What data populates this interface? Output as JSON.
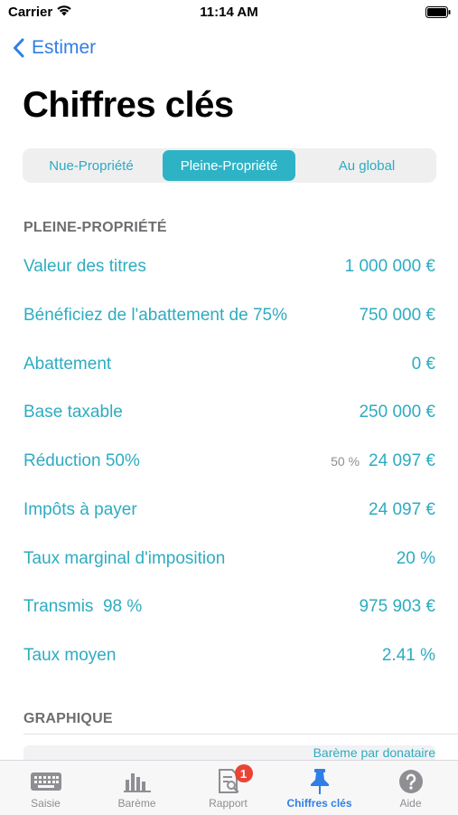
{
  "status_bar": {
    "carrier": "Carrier",
    "time": "11:14 AM"
  },
  "nav": {
    "back_label": "Estimer",
    "title": "Chiffres clés"
  },
  "segments": [
    {
      "label": "Nue-Propriété",
      "selected": false
    },
    {
      "label": "Pleine-Propriété",
      "selected": true
    },
    {
      "label": "Au global",
      "selected": false
    }
  ],
  "section_pp": {
    "header": "PLEINE-PROPRIÉTÉ",
    "rows": [
      {
        "label": "Valeur des titres",
        "value": "1 000 000 €"
      },
      {
        "label": "Bénéficiez de l'abattement de 75%",
        "value": "750 000 €"
      },
      {
        "label": "Abattement",
        "value": "0 €"
      },
      {
        "label": "Base taxable",
        "value": "250 000 €"
      },
      {
        "label": "Réduction 50%",
        "pct": "50 %",
        "value": "24 097 €"
      },
      {
        "label": "Impôts à payer",
        "value": "24 097 €"
      },
      {
        "label": "Taux marginal d'imposition",
        "value": "20 %"
      },
      {
        "label": "Transmis  98 %",
        "value": "975 903 €"
      },
      {
        "label": "Taux moyen",
        "value": "2.41 %"
      }
    ]
  },
  "section_graph": {
    "header": "GRAPHIQUE",
    "chart_label": "Barème par donataire"
  },
  "tabs": [
    {
      "label": "Saisie",
      "icon": "keyboard-icon",
      "active": false
    },
    {
      "label": "Barème",
      "icon": "bar-chart-icon",
      "active": false
    },
    {
      "label": "Rapport",
      "icon": "report-search-icon",
      "active": false,
      "badge": "1"
    },
    {
      "label": "Chiffres clés",
      "icon": "pin-icon",
      "active": true
    },
    {
      "label": "Aide",
      "icon": "help-icon",
      "active": false
    }
  ],
  "colors": {
    "accent": "#2eacc1",
    "ios_blue": "#2f7fe6",
    "segment_selected": "#2eb3c6",
    "badge": "#ea4335"
  }
}
